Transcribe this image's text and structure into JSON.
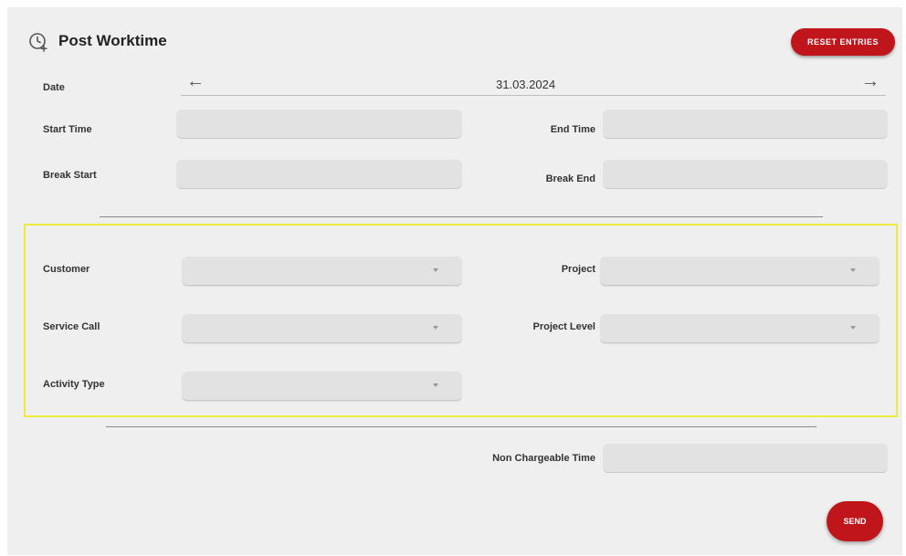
{
  "header": {
    "title": "Post Worktime",
    "reset_label": "RESET ENTRIES"
  },
  "date": {
    "label": "Date",
    "value": "31.03.2024",
    "prev_glyph": "←",
    "next_glyph": "→"
  },
  "times": {
    "start_label": "Start Time",
    "end_label": "End Time",
    "break_start_label": "Break Start",
    "break_end_label": "Break End",
    "start_value": "",
    "end_value": "",
    "break_start_value": "",
    "break_end_value": ""
  },
  "assignment": {
    "customer_label": "Customer",
    "project_label": "Project",
    "service_call_label": "Service Call",
    "project_level_label": "Project Level",
    "activity_type_label": "Activity Type",
    "customer_value": "",
    "project_value": "",
    "service_call_value": "",
    "project_level_value": "",
    "activity_type_value": ""
  },
  "non_chargeable": {
    "label": "Non Chargeable Time",
    "value": ""
  },
  "send_label": "SEND",
  "colors": {
    "accent": "#c0151b",
    "highlight": "#f0ea3a",
    "background": "#efefef",
    "field": "#e2e2e2"
  },
  "icons": {
    "header": "clock-plus-icon",
    "prev": "arrow-left-icon",
    "next": "arrow-right-icon",
    "dropdown": "caret-down-icon"
  }
}
